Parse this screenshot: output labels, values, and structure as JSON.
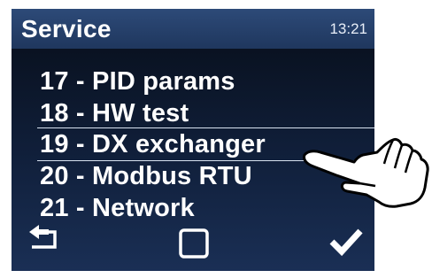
{
  "header": {
    "title": "Service",
    "time": "13:21"
  },
  "menu": {
    "items": [
      {
        "label": "17 - PID params",
        "selected": false
      },
      {
        "label": "18 - HW test",
        "selected": false
      },
      {
        "label": "19 - DX exchanger",
        "selected": true
      },
      {
        "label": "20 - Modbus RTU",
        "selected": false
      },
      {
        "label": "21 - Network",
        "selected": false
      }
    ]
  },
  "footer": {
    "icons": [
      "back-arrow-icon",
      "square-icon",
      "checkmark-icon"
    ]
  },
  "colors": {
    "header": "#2d4a78",
    "background": "#0b1426",
    "text": "#ffffff"
  }
}
